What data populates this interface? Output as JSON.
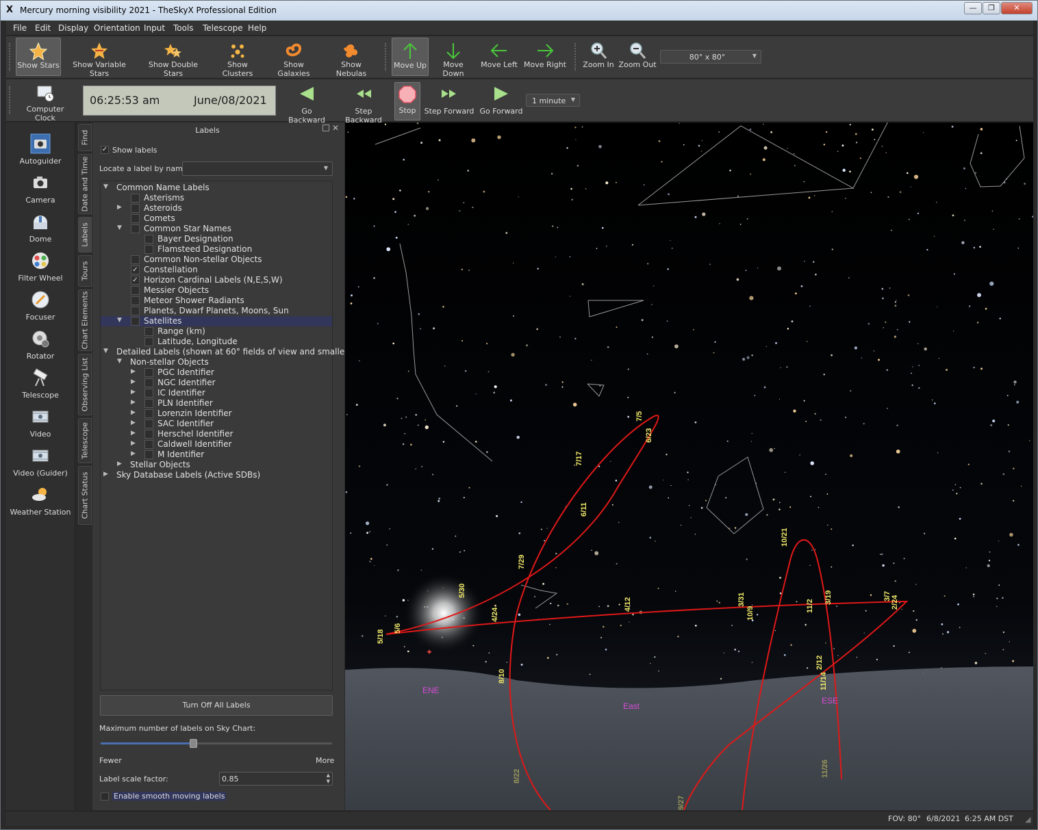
{
  "window": {
    "title": "Mercury morning visibility 2021 - TheSkyX Professional Edition",
    "app_icon": "X",
    "minimize": "—",
    "restore": "❐",
    "close": "✕"
  },
  "menu": [
    "File",
    "Edit",
    "Display",
    "Orientation",
    "Input",
    "Tools",
    "Telescope",
    "Help"
  ],
  "toolbar1": {
    "buttons": [
      "Show Stars",
      "Show Variable Stars",
      "Show Double Stars",
      "Show Clusters",
      "Show Galaxies",
      "Show Nebulas",
      "Move Up",
      "Move Down",
      "Move Left",
      "Move Right",
      "Zoom In",
      "Zoom Out"
    ],
    "fov_value": "80° x 80°"
  },
  "toolbar2": {
    "computer_clock": "Computer Clock",
    "time": "06:25:53 am",
    "date": "June/08/2021",
    "buttons": [
      "Go Backward",
      "Step Backward",
      "Stop",
      "Step Forward",
      "Go Forward"
    ],
    "step_value": "1 minute"
  },
  "leftbar": [
    "Autoguider",
    "Camera",
    "Dome",
    "Filter Wheel",
    "Focuser",
    "Rotator",
    "Telescope",
    "Video",
    "Video (Guider)",
    "Weather Station"
  ],
  "vtabs": [
    "Find",
    "Date and Time",
    "Labels",
    "Tours",
    "Chart Elements",
    "Observing List",
    "Telescope",
    "Chart Status"
  ],
  "panel": {
    "title": "Labels",
    "show_labels": "Show labels",
    "locate_label": "Locate a label by name:",
    "locate_value": "",
    "tree": [
      {
        "label": "Common Name Labels",
        "depth": 0,
        "exp": "open",
        "box": false
      },
      {
        "label": "Asterisms",
        "depth": 2,
        "exp": "",
        "box": true,
        "checked": false
      },
      {
        "label": "Asteroids",
        "depth": 2,
        "exp": "closed",
        "box": true,
        "checked": false
      },
      {
        "label": "Comets",
        "depth": 2,
        "exp": "",
        "box": true,
        "checked": false
      },
      {
        "label": "Common Star Names",
        "depth": 2,
        "exp": "open",
        "box": true,
        "checked": false
      },
      {
        "label": "Bayer Designation",
        "depth": 3,
        "exp": "",
        "box": true,
        "checked": false
      },
      {
        "label": "Flamsteed Designation",
        "depth": 3,
        "exp": "",
        "box": true,
        "checked": false
      },
      {
        "label": "Common Non-stellar Objects",
        "depth": 2,
        "exp": "",
        "box": true,
        "checked": false
      },
      {
        "label": "Constellation",
        "depth": 2,
        "exp": "",
        "box": true,
        "checked": true
      },
      {
        "label": "Horizon Cardinal Labels (N,E,S,W)",
        "depth": 2,
        "exp": "",
        "box": true,
        "checked": true
      },
      {
        "label": "Messier Objects",
        "depth": 2,
        "exp": "",
        "box": true,
        "checked": false
      },
      {
        "label": "Meteor Shower Radiants",
        "depth": 2,
        "exp": "",
        "box": true,
        "checked": false
      },
      {
        "label": "Planets, Dwarf Planets, Moons, Sun",
        "depth": 2,
        "exp": "",
        "box": true,
        "checked": false
      },
      {
        "label": "Satellites",
        "depth": 2,
        "exp": "open",
        "box": true,
        "checked": false,
        "selected": true
      },
      {
        "label": "Range (km)",
        "depth": 3,
        "exp": "",
        "box": true,
        "checked": false
      },
      {
        "label": "Latitude, Longitude",
        "depth": 3,
        "exp": "",
        "box": true,
        "checked": false
      },
      {
        "label": "Detailed Labels (shown at 60° fields of view and smaller)",
        "depth": 0,
        "exp": "open",
        "box": false
      },
      {
        "label": "Non-stellar Objects",
        "depth": 1,
        "exp": "open",
        "box": false
      },
      {
        "label": "PGC Identifier",
        "depth": 3,
        "exp": "closed",
        "box": true,
        "checked": false
      },
      {
        "label": "NGC Identifier",
        "depth": 3,
        "exp": "closed",
        "box": true,
        "checked": false
      },
      {
        "label": "IC Identifier",
        "depth": 3,
        "exp": "closed",
        "box": true,
        "checked": false
      },
      {
        "label": "PLN Identifier",
        "depth": 3,
        "exp": "closed",
        "box": true,
        "checked": false
      },
      {
        "label": "Lorenzin Identifier",
        "depth": 3,
        "exp": "closed",
        "box": true,
        "checked": false
      },
      {
        "label": "SAC Identifier",
        "depth": 3,
        "exp": "closed",
        "box": true,
        "checked": false
      },
      {
        "label": "Herschel Identifier",
        "depth": 3,
        "exp": "closed",
        "box": true,
        "checked": false
      },
      {
        "label": "Caldwell Identifier",
        "depth": 3,
        "exp": "closed",
        "box": true,
        "checked": false
      },
      {
        "label": "M Identifier",
        "depth": 3,
        "exp": "closed",
        "box": true,
        "checked": false
      },
      {
        "label": "Stellar Objects",
        "depth": 1,
        "exp": "closed",
        "box": false
      },
      {
        "label": "Sky Database Labels (Active SDBs)",
        "depth": 0,
        "exp": "closed",
        "box": false
      }
    ],
    "turn_off": "Turn Off All Labels",
    "max_labels": "Maximum number of labels on Sky Chart:",
    "max_labels_level": 0.4,
    "fewer": "Fewer",
    "more": "More",
    "scale_label": "Label scale factor:",
    "scale_value": "0.85",
    "smooth_label": "Enable smooth moving labels"
  },
  "chart": {
    "cardinals": [
      "ENE",
      "East",
      "ESE"
    ],
    "dates": [
      "5/18",
      "5/6",
      "5/30",
      "7/29",
      "6/11",
      "7/17",
      "7/5",
      "6/23",
      "4/24",
      "4/12",
      "3/31",
      "10/9",
      "10/21",
      "11/2",
      "3/19",
      "3/7",
      "2/24",
      "2/12",
      "11/14",
      "8/10",
      "8/22",
      "9/27",
      "11/26"
    ],
    "path_color": "#e01818",
    "date_color": "#f2e96a",
    "cardinal_color": "#d84bd8"
  },
  "status": {
    "fov": "FOV: 80°",
    "date": "6/8/2021",
    "time": "6:25 AM DST"
  }
}
